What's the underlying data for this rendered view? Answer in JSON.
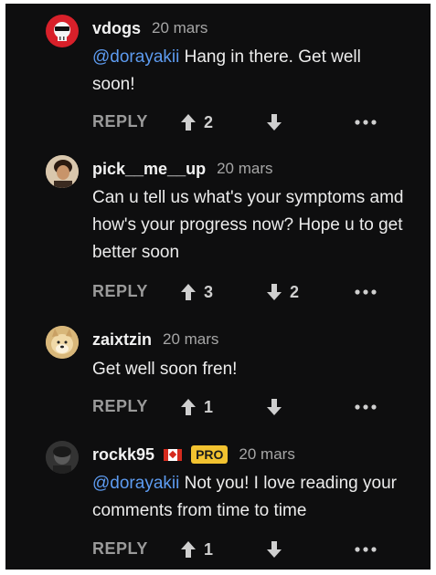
{
  "comments": [
    {
      "username": "vdogs",
      "time": "20 mars",
      "mention": "@dorayakii",
      "text": " Hang in there. Get well soon!",
      "reply_label": "REPLY",
      "upvotes": "2",
      "downvotes": "",
      "avatar_icon": "skull-avatar-icon"
    },
    {
      "username": "pick__me__up",
      "time": "20 mars",
      "mention": "",
      "text": "Can u tell us what's your symptoms amd how's your progress now? Hope u to get better soon",
      "reply_label": "REPLY",
      "upvotes": "3",
      "downvotes": "2",
      "avatar_icon": "photo-avatar-icon"
    },
    {
      "username": "zaixtzin",
      "time": "20 mars",
      "mention": "",
      "text": "Get well soon fren!",
      "reply_label": "REPLY",
      "upvotes": "1",
      "downvotes": "",
      "avatar_icon": "doge-avatar-icon"
    },
    {
      "username": "rockk95",
      "time": "20 mars",
      "badge": "PRO",
      "flag_icon": "canada-flag-icon",
      "mention": "@dorayakii",
      "text": " Not you! I love reading your comments from time to time",
      "reply_label": "REPLY",
      "upvotes": "1",
      "downvotes": "",
      "avatar_icon": "dark-photo-avatar-icon"
    }
  ],
  "colors": {
    "background": "#0e0e0f",
    "mention": "#5d9bf0",
    "pro_badge": "#f2c230",
    "secondary_text": "#a6a6a6"
  }
}
